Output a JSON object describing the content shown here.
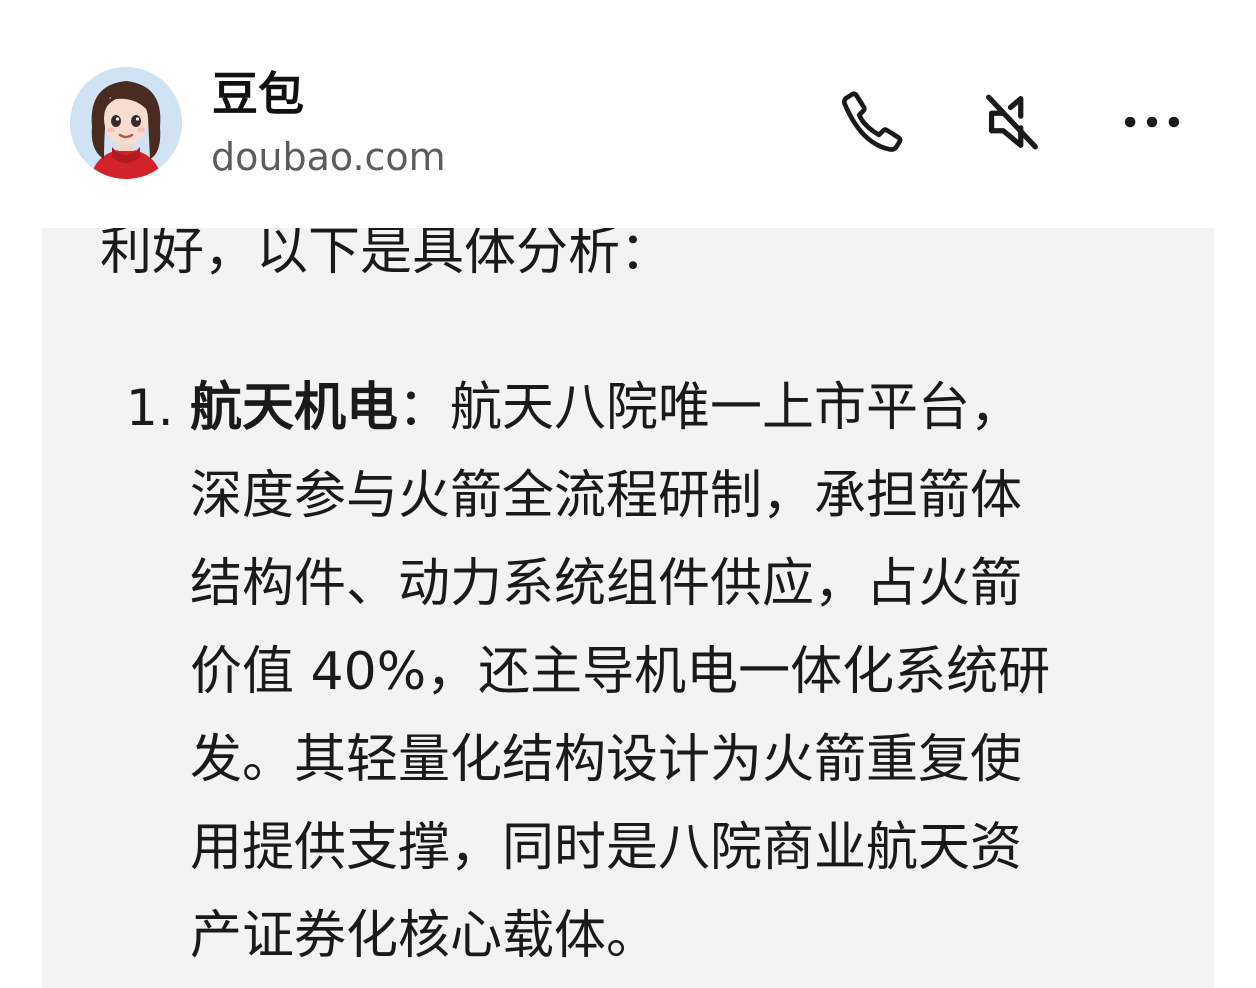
{
  "header": {
    "title": "豆包",
    "subtitle": "doubao.com",
    "actions": [
      {
        "icon": "phone-icon"
      },
      {
        "icon": "mute-speaker-icon"
      },
      {
        "icon": "more-dots-icon"
      }
    ]
  },
  "message": {
    "intro": "利好，以下是具体分析：",
    "item1": {
      "number": "1.",
      "title": "航天机电",
      "line1_rest": "：航天八院唯一上市平台，",
      "line2": "深度参与火箭全流程研制，承担箭体",
      "line3": "结构件、动力系统组件供应，占火箭",
      "line4": "价值 40%，还主导机电一体化系统研",
      "line5": "发。其轻量化结构设计为火箭重复使",
      "line6": "用提供支撑，同时是八院商业航天资",
      "line7": "产证券化核心载体。"
    }
  },
  "colors": {
    "panel_bg": "#f3f3f3",
    "header_bg": "#ffffff",
    "text": "#1a1a1a",
    "subtitle": "#5c5c5c"
  }
}
